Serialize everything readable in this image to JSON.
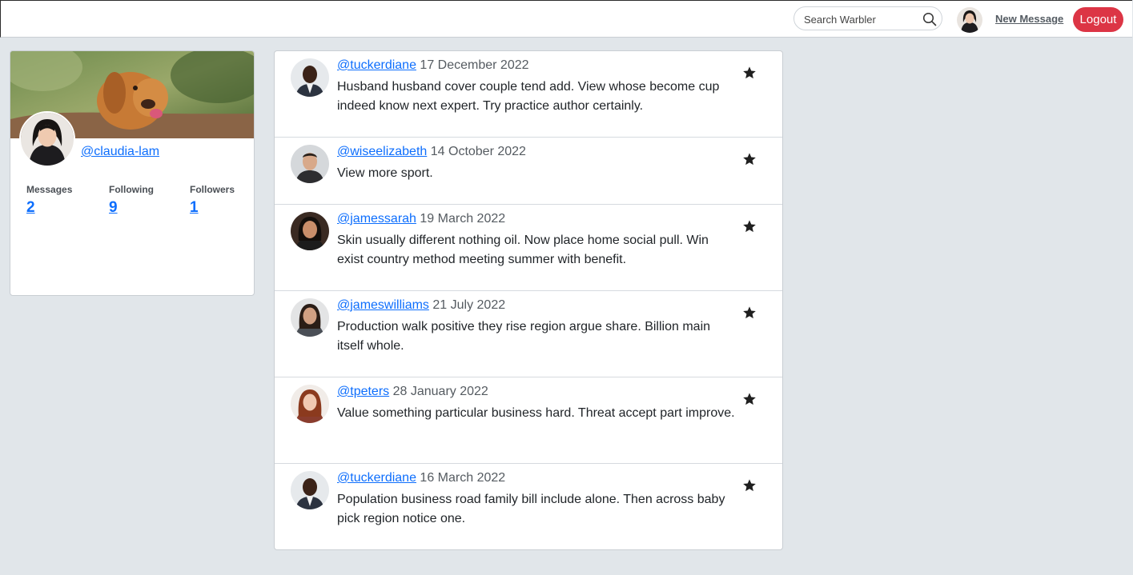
{
  "navbar": {
    "search": {
      "placeholder": "Search Warbler",
      "icon": "search-icon"
    },
    "new_message_label": "New Message",
    "logout_label": "Logout",
    "accent_color": "#dc3545"
  },
  "profile": {
    "username": "@claudia-lam",
    "stats": [
      {
        "label": "Messages",
        "value": "2"
      },
      {
        "label": "Following",
        "value": "9"
      },
      {
        "label": "Followers",
        "value": "1"
      }
    ]
  },
  "messages": [
    {
      "username": "@tuckerdiane",
      "date": "17 December 2022",
      "text": "Husband husband cover couple tend add. View whose become cup indeed know next expert. Try practice author certainly."
    },
    {
      "username": "@wiseelizabeth",
      "date": "14 October 2022",
      "text": "View more sport."
    },
    {
      "username": "@jamessarah",
      "date": "19 March 2022",
      "text": "Skin usually different nothing oil. Now place home social pull. Win exist country method meeting summer with benefit."
    },
    {
      "username": "@jameswilliams",
      "date": "21 July 2022",
      "text": "Production walk positive they rise region argue share. Billion main itself whole."
    },
    {
      "username": "@tpeters",
      "date": "28 January 2022",
      "text": "Value something particular business hard. Threat accept part improve."
    },
    {
      "username": "@tuckerdiane",
      "date": "16 March 2022",
      "text": "Population business road family bill include alone. Then across baby pick region notice one."
    }
  ]
}
